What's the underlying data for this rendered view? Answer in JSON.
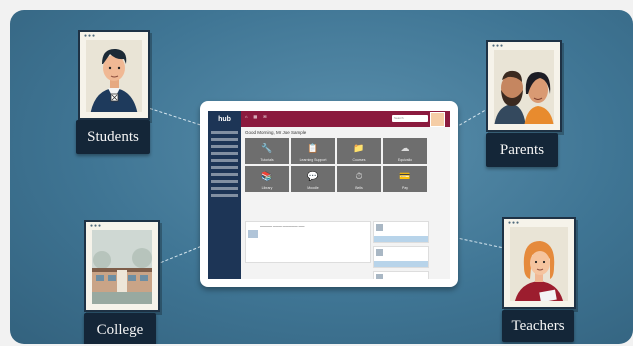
{
  "labels": {
    "students": "Students",
    "parents": "Parents",
    "college": "College",
    "teachers": "Teachers"
  },
  "app": {
    "logo": "hub",
    "search_placeholder": "Search",
    "greeting": "Good Morning, Mr Joe Sample",
    "tiles": [
      {
        "icon": "🔧",
        "label": "Tutorials"
      },
      {
        "icon": "📋",
        "label": "Learning Support"
      },
      {
        "icon": "📁",
        "label": "Courses"
      },
      {
        "icon": "☁",
        "label": "Equivalio"
      },
      {
        "icon": "📚",
        "label": "Library"
      },
      {
        "icon": "💬",
        "label": "Moodle"
      },
      {
        "icon": "⏱",
        "label": "Bells"
      },
      {
        "icon": "💳",
        "label": "Pay"
      }
    ]
  },
  "colors": {
    "stage": "#3f7594",
    "label_bg": "#142638",
    "app_topbar": "#8b1a3e",
    "app_sidebar": "#1d3556"
  }
}
